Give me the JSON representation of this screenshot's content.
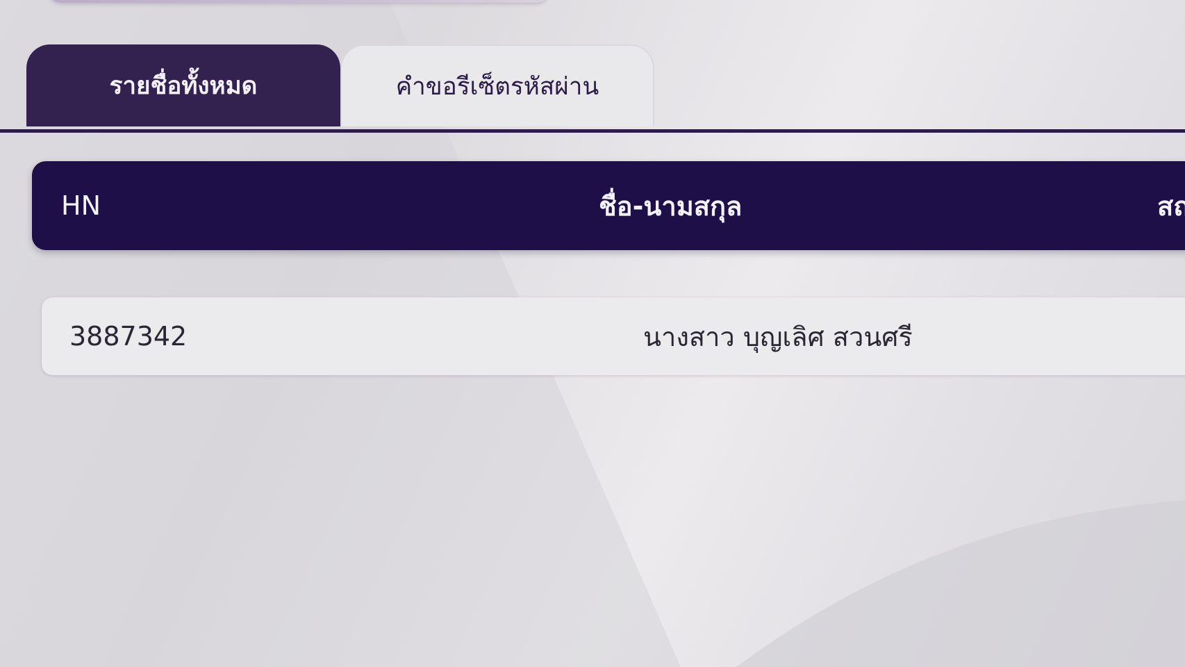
{
  "tabs": [
    {
      "label": "รายชื่อทั้งหมด",
      "active": true
    },
    {
      "label": "คำขอรีเซ็ตรหัสผ่าน",
      "active": false
    }
  ],
  "table": {
    "columns": [
      "HN",
      "ชื่อ-นามสกุล",
      "สถ"
    ],
    "rows": [
      {
        "hn": "3887342",
        "name": "นางสาว บุญเลิศ สวนศรี"
      }
    ]
  },
  "colors": {
    "primary": "#1f0f49",
    "active_tab": "#33214f",
    "row_background": "#ebeaec"
  }
}
